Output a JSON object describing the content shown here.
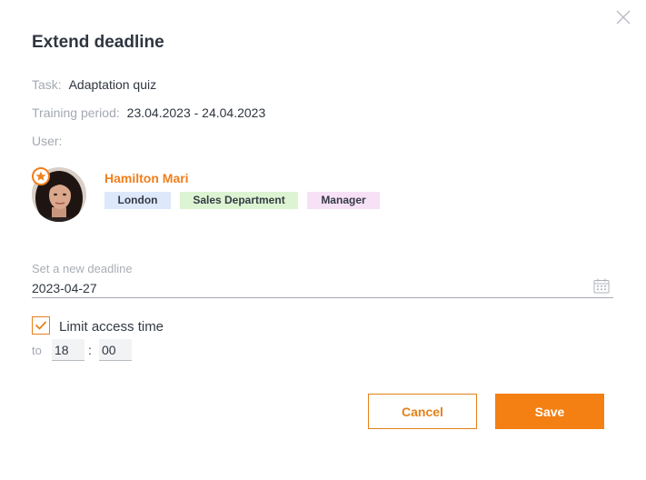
{
  "dialog": {
    "title": "Extend deadline"
  },
  "task": {
    "label": "Task:",
    "value": "Adaptation quiz"
  },
  "training_period": {
    "label": "Training period:",
    "value": "23.04.2023 - 24.04.2023"
  },
  "user": {
    "label": "User:",
    "name": "Hamilton Mari",
    "tags": [
      "London",
      "Sales Department",
      "Manager"
    ],
    "badge_icon": "star-icon"
  },
  "deadline": {
    "label": "Set a new deadline",
    "value": "2023-04-27",
    "icon": "calendar-icon"
  },
  "limit_access": {
    "checked": true,
    "label": "Limit access time",
    "to_label": "to",
    "hours": "18",
    "separator": ":",
    "minutes": "00"
  },
  "actions": {
    "cancel_label": "Cancel",
    "save_label": "Save"
  },
  "colors": {
    "accent": "#f47f12",
    "tag_city": "#dde8fb",
    "tag_department": "#ddf4d2",
    "tag_role": "#f7e1f7"
  }
}
